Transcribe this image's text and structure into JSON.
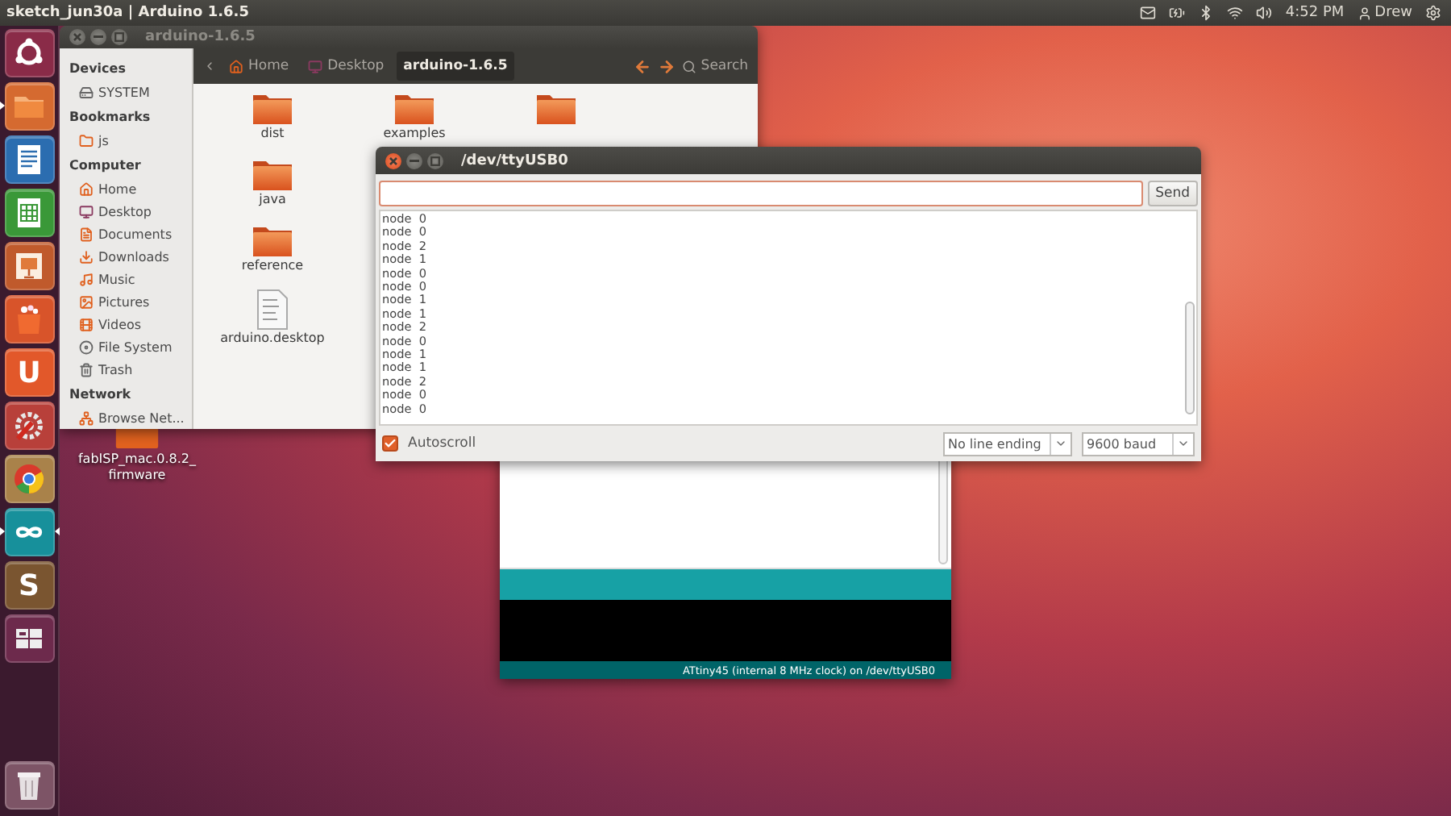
{
  "top_panel": {
    "app_title": "sketch_jun30a | Arduino 1.6.5",
    "clock": "4:52 PM",
    "user": "Drew"
  },
  "launcher": [
    {
      "kind": "ubuntu",
      "running": false,
      "selected": false
    },
    {
      "kind": "files",
      "running": true,
      "selected": false
    },
    {
      "kind": "writer",
      "running": false,
      "selected": false
    },
    {
      "kind": "calc",
      "running": false,
      "selected": false
    },
    {
      "kind": "impress",
      "running": false,
      "selected": false
    },
    {
      "kind": "software",
      "running": false,
      "selected": false
    },
    {
      "kind": "letter",
      "glyph": "U",
      "running": false,
      "selected": false
    },
    {
      "kind": "settings",
      "running": false,
      "selected": false
    },
    {
      "kind": "browser",
      "running": false,
      "selected": false
    },
    {
      "kind": "arduino",
      "running": true,
      "selected": true
    },
    {
      "kind": "editor",
      "glyph": "S",
      "running": false,
      "selected": false
    },
    {
      "kind": "workspaces",
      "running": false,
      "selected": false
    },
    {
      "kind": "trash",
      "running": false,
      "selected": false
    }
  ],
  "file_manager": {
    "title": "arduino-1.6.5",
    "sidebar": [
      {
        "heading": "Devices",
        "items": [
          {
            "label": "SYSTEM",
            "kind": "drive"
          }
        ]
      },
      {
        "heading": "Bookmarks",
        "items": [
          {
            "label": "js",
            "kind": "folder"
          }
        ]
      },
      {
        "heading": "Computer",
        "items": [
          {
            "label": "Home",
            "kind": "home"
          },
          {
            "label": "Desktop",
            "kind": "desktop"
          },
          {
            "label": "Documents",
            "kind": "documents"
          },
          {
            "label": "Downloads",
            "kind": "downloads"
          },
          {
            "label": "Music",
            "kind": "music"
          },
          {
            "label": "Pictures",
            "kind": "pictures"
          },
          {
            "label": "Videos",
            "kind": "videos"
          },
          {
            "label": "File System",
            "kind": "filesystem"
          },
          {
            "label": "Trash",
            "kind": "trash"
          }
        ]
      },
      {
        "heading": "Network",
        "items": [
          {
            "label": "Browse Net...",
            "kind": "network"
          }
        ]
      }
    ],
    "path": [
      {
        "label": "Home",
        "kind": "home",
        "selected": false
      },
      {
        "label": "Desktop",
        "kind": "desktop",
        "selected": false
      },
      {
        "label": "arduino-1.6.5",
        "selected": true
      }
    ],
    "search": "Search",
    "files": [
      {
        "name": "dist",
        "kind": "folder"
      },
      {
        "name": "examples",
        "kind": "folder"
      },
      {
        "kind": "folder"
      },
      {
        "name": "java",
        "kind": "folder"
      },
      {
        "name": "reference",
        "kind": "folder"
      },
      {
        "name": "arduino.desktop",
        "kind": "text"
      }
    ]
  },
  "desktop_icon": {
    "label": "fabISP_mac.0.8.2_ firmware"
  },
  "arduino_ide": {
    "status": "ATtiny45 (internal 8 MHz clock) on /dev/ttyUSB0"
  },
  "serial_monitor": {
    "title": "/dev/ttyUSB0",
    "send": "Send",
    "lines": [
      "node  0",
      "node  0",
      "node  2",
      "node  1",
      "node  0",
      "node  0",
      "node  1",
      "node  1",
      "node  2",
      "node  0",
      "node  1",
      "node  1",
      "node  2",
      "node  0",
      "node  0"
    ],
    "autoscroll": {
      "label": "Autoscroll",
      "checked": true
    },
    "line_ending": "No line ending",
    "baud": "9600 baud"
  }
}
